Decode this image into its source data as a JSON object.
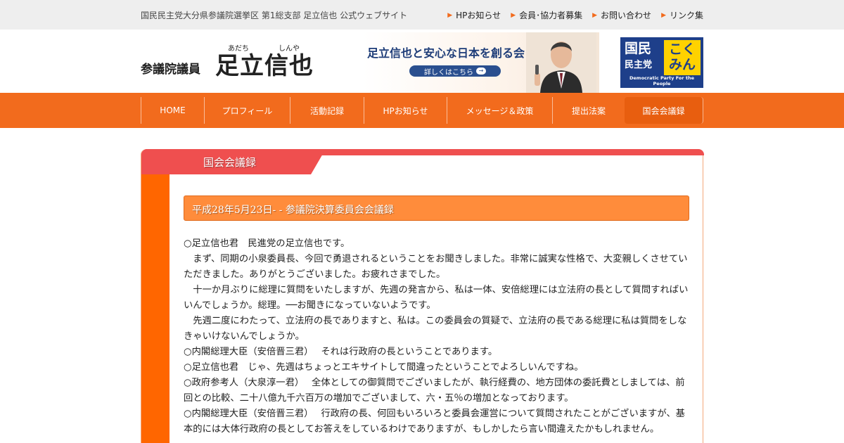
{
  "topbar": {
    "site_desc": "国民民主党大分県参議院選挙区 第1総支部 足立信也 公式ウェブサイト",
    "links": [
      "HPお知らせ",
      "会員･協力者募集",
      "お問い合わせ",
      "リンク集"
    ]
  },
  "header": {
    "title_prefix": "参議院議員",
    "name": "足立信也",
    "ruby_adachi": "あだち",
    "ruby_shinya": "しんや"
  },
  "banner": {
    "title": "足立信也と安心な日本を創る会",
    "button_label": "詳しくはこちら"
  },
  "logo": {
    "line1": "国民",
    "line2": "民主党",
    "kokumin": "こく\nみん",
    "tagline": "Democratic Party For the People"
  },
  "nav": {
    "items": [
      "HOME",
      "プロフィール",
      "活動記録",
      "HPお知らせ",
      "メッセージ＆政策",
      "提出法案",
      "国会会議録"
    ],
    "active_index": 6
  },
  "section": {
    "heading": "国会会議録",
    "entry_title": "平成28年5月23日- - 参議院決算委員会会議録"
  },
  "body": {
    "paragraphs": [
      "○足立信也君　民進党の足立信也です。",
      "　まず、同期の小泉委員長、今回で勇退されるということをお聞きしました。非常に誠実な性格で、大変親しくさせていただきました。ありがとうございました。お疲れさまでした。",
      "　十一か月ぶりに総理に質問をいたしますが、先週の発言から、私は一体、安倍総理には立法府の長として質問すればいいんでしょうか。総理。──お聞きになっていないようです。",
      "　先週二度にわたって、立法府の長でありますと、私は。この委員会の質疑で、立法府の長である総理に私は質問をしなきゃいけないんでしょうか。",
      "○内閣総理大臣（安倍晋三君）　 それは行政府の長ということであります。",
      "○足立信也君　じゃ、先週はちょっとエキサイトして間違ったということでよろしいんですね。",
      "○政府参考人（大泉淳一君）　 全体としての御質問でございましたが、執行経費の、地方団体の委託費としましては、前回との比較、二十八億九千六百万の増加でございまして、六・五％の増加となっております。",
      "○内閣総理大臣（安倍晋三君）　 行政府の長、何回もいろいろと委員会運営について質問されたことがございますが、基本的には大体行政府の長としてお答えをしているわけでありますが、もしかしたら言い間違えたかもしれません。"
    ]
  },
  "colors": {
    "nav_orange": "#f26b1d",
    "tab_red": "#ef4f4f",
    "entry_orange": "#ff8c3b",
    "logo_blue": "#1e3f8a",
    "logo_yellow": "#ffd200"
  }
}
